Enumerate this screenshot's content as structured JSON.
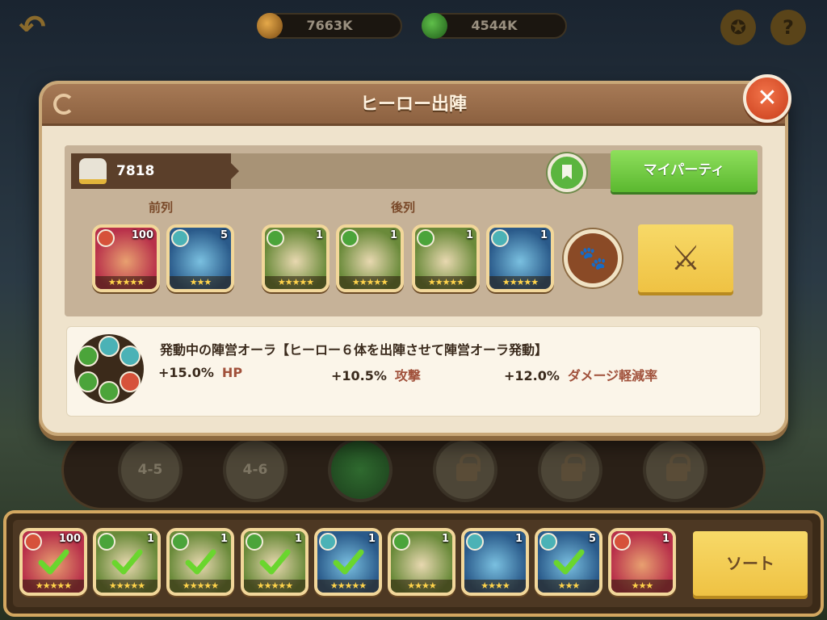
{
  "topbar": {
    "gold": "7663K",
    "gems": "4544K"
  },
  "stages": [
    "4-5",
    "4-6"
  ],
  "dialog": {
    "title": "ヒーロー出陣",
    "power": "7818",
    "myparty_label": "マイパーティ",
    "front_label": "前列",
    "back_label": "後列",
    "front_heroes": [
      {
        "level": "100",
        "faction": "fire",
        "stars": 5
      },
      {
        "level": "5",
        "faction": "undead",
        "stars": 3
      }
    ],
    "back_heroes": [
      {
        "level": "1",
        "faction": "forest",
        "stars": 5
      },
      {
        "level": "1",
        "faction": "forest",
        "stars": 5
      },
      {
        "level": "1",
        "faction": "forest",
        "stars": 5
      },
      {
        "level": "1",
        "faction": "undead",
        "stars": 5
      }
    ],
    "aura": {
      "title": "発動中の陣営オーラ【ヒーロー６体を出陣させて陣営オーラ発動】",
      "stats": [
        {
          "value": "+15.0%",
          "name": "HP"
        },
        {
          "value": "+10.5%",
          "name": "攻撃"
        },
        {
          "value": "+12.0%",
          "name": "ダメージ軽減率"
        }
      ]
    }
  },
  "roster": {
    "sort_label": "ソート",
    "heroes": [
      {
        "level": "100",
        "faction": "fire",
        "stars": 5,
        "selected": true
      },
      {
        "level": "1",
        "faction": "forest",
        "stars": 5,
        "selected": true
      },
      {
        "level": "1",
        "faction": "forest",
        "stars": 5,
        "selected": true
      },
      {
        "level": "1",
        "faction": "forest",
        "stars": 5,
        "selected": true
      },
      {
        "level": "1",
        "faction": "undead",
        "stars": 5,
        "selected": true
      },
      {
        "level": "1",
        "faction": "forest",
        "stars": 4,
        "selected": false
      },
      {
        "level": "1",
        "faction": "undead",
        "stars": 4,
        "selected": false
      },
      {
        "level": "5",
        "faction": "undead",
        "stars": 3,
        "selected": true
      },
      {
        "level": "1",
        "faction": "fire",
        "stars": 3,
        "selected": false
      }
    ]
  },
  "colors": {
    "fire": "#d6523a",
    "forest": "#4ba43a",
    "undead": "#4bb2b6",
    "accent_green": "#5bb82f",
    "accent_gold": "#efc243"
  }
}
